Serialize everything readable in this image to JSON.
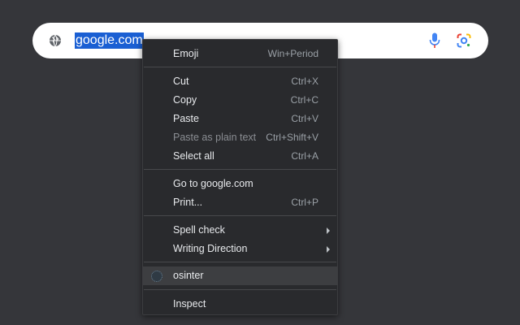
{
  "omnibox": {
    "url": "google.com",
    "site_info_icon": "globe-icon",
    "voice_icon": "microphone-icon",
    "lens_icon": "google-lens-icon"
  },
  "context_menu": {
    "items": [
      {
        "label": "Emoji",
        "shortcut": "Win+Period"
      },
      {
        "label": "Cut",
        "shortcut": "Ctrl+X"
      },
      {
        "label": "Copy",
        "shortcut": "Ctrl+C"
      },
      {
        "label": "Paste",
        "shortcut": "Ctrl+V"
      },
      {
        "label": "Paste as plain text",
        "shortcut": "Ctrl+Shift+V",
        "disabled": true
      },
      {
        "label": "Select all",
        "shortcut": "Ctrl+A"
      },
      {
        "label": "Go to google.com",
        "shortcut": ""
      },
      {
        "label": "Print...",
        "shortcut": "Ctrl+P"
      },
      {
        "label": "Spell check",
        "shortcut": "",
        "submenu": true
      },
      {
        "label": "Writing Direction",
        "shortcut": "",
        "submenu": true
      },
      {
        "label": "osinter",
        "shortcut": "",
        "extension_icon": "osinter-extension-icon"
      },
      {
        "label": "Inspect",
        "shortcut": ""
      }
    ]
  },
  "colors": {
    "background": "#35363a",
    "menu_background": "#292a2d",
    "selection": "#1a5fd3",
    "menu_text": "#e8eaed",
    "shortcut_text": "#9aa0a6",
    "mic_blue": "#4285f4",
    "mic_red": "#ea4335"
  }
}
